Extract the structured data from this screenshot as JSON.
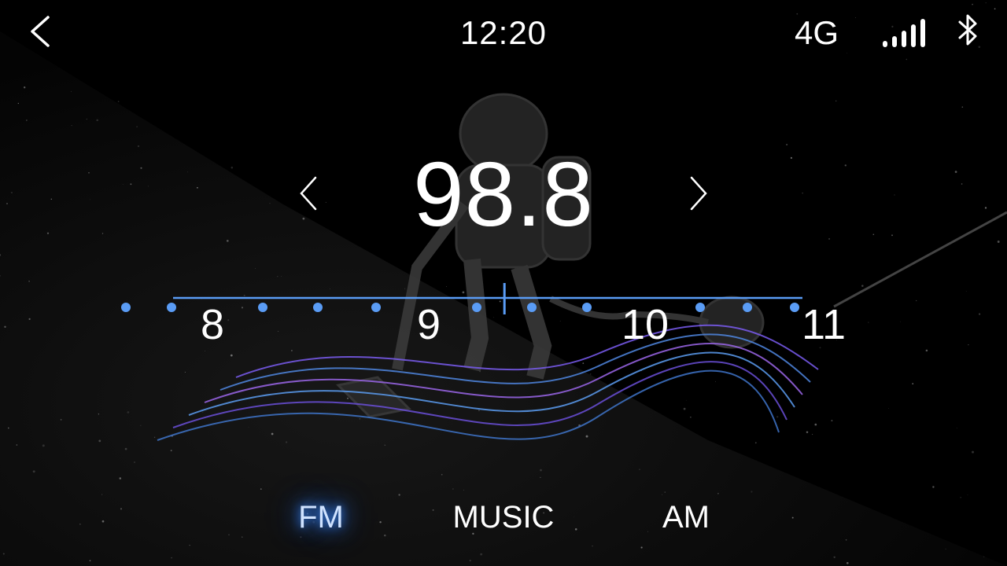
{
  "status_bar": {
    "time": "12:20",
    "network": "4G",
    "icons": [
      "back-icon",
      "signal-bars-icon",
      "bluetooth-icon"
    ]
  },
  "tuner": {
    "frequency": "98.8",
    "scale_labels": [
      "8",
      "9",
      "10",
      "11"
    ],
    "indicator_value": 9.35,
    "accent_color": "#5a9cf5",
    "icons": [
      "chevron-left-icon",
      "chevron-right-icon"
    ]
  },
  "bands": {
    "items": [
      "FM",
      "MUSIC",
      "AM"
    ],
    "active": "FM"
  }
}
